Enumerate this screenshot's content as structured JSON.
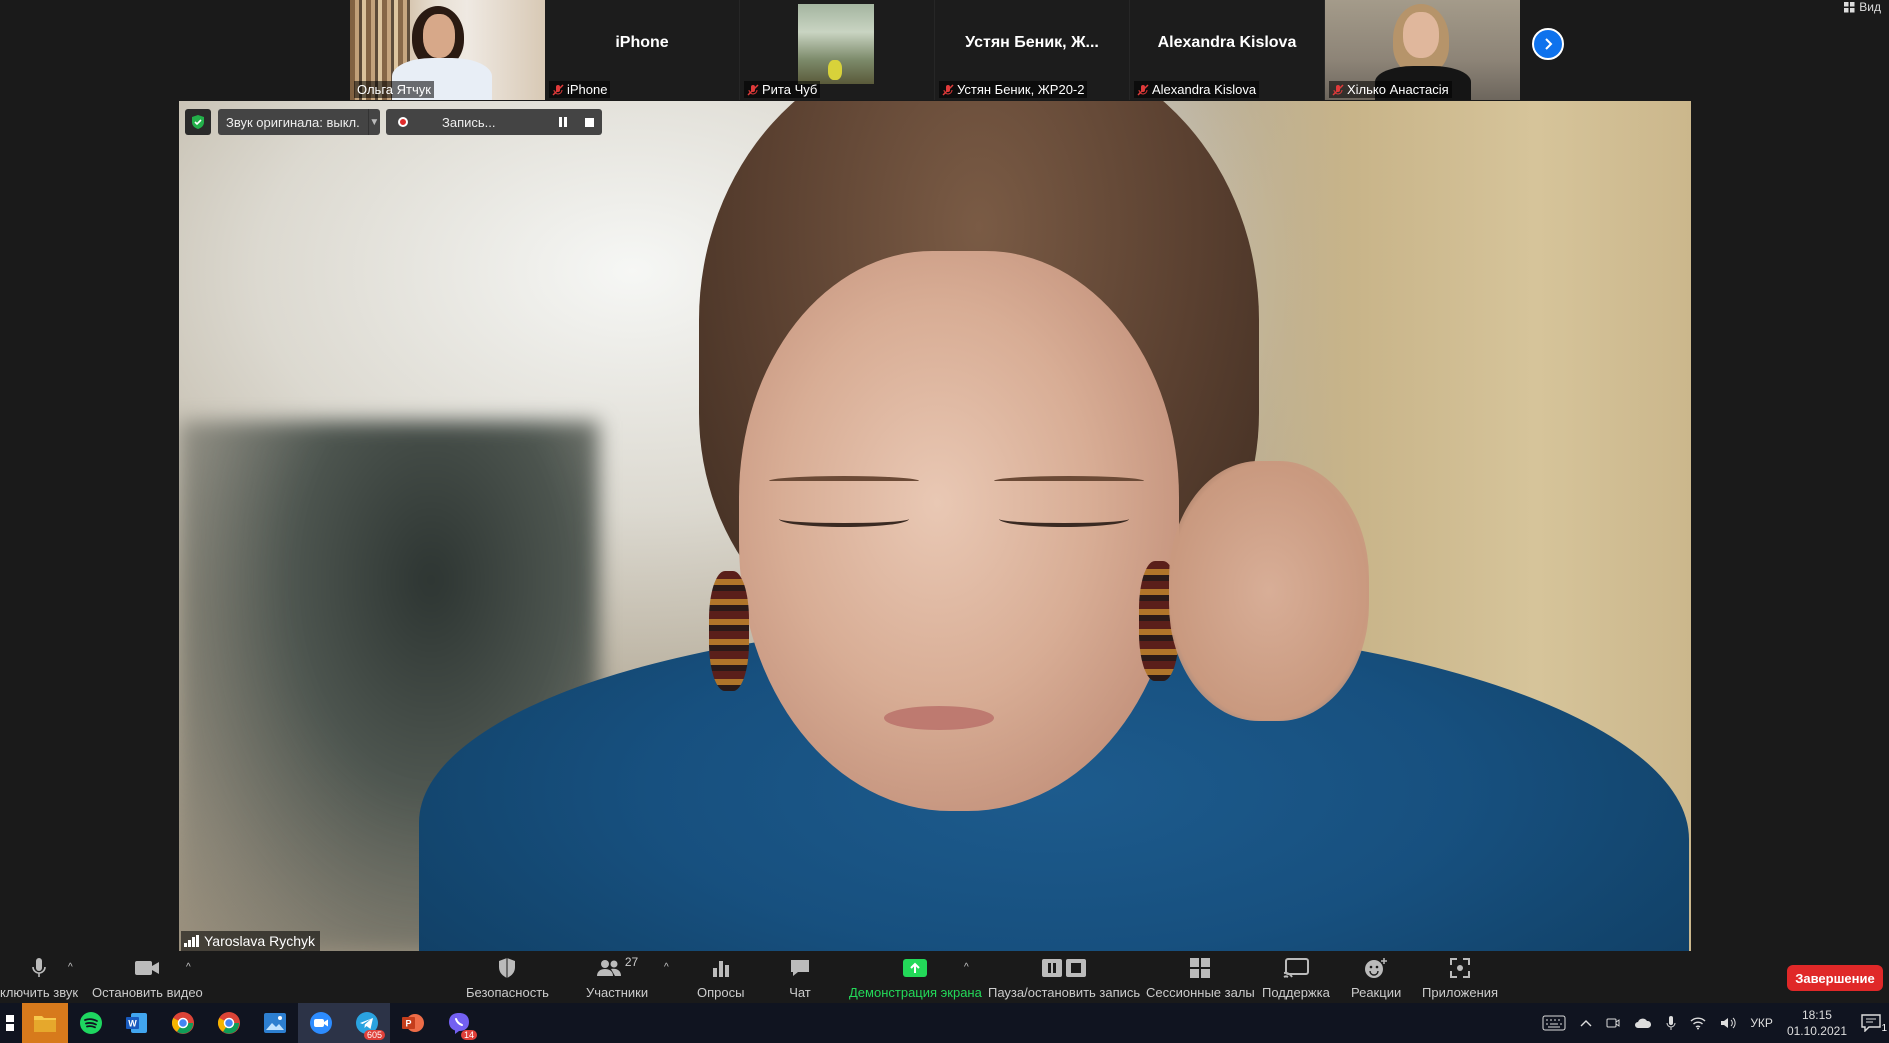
{
  "strip": {
    "tiles": [
      {
        "label": "Ольга Ятчук",
        "name": ""
      },
      {
        "label": "iPhone",
        "name": "iPhone"
      },
      {
        "label": "Рита Чуб",
        "name": ""
      },
      {
        "label": "Устян Беник, ЖР20-2",
        "name": "Устян  Беник,  Ж..."
      },
      {
        "label": "Alexandra Kislova",
        "name": "Alexandra Kislova"
      },
      {
        "label": "Хілько  Анастасія",
        "name": ""
      }
    ],
    "view_label": "Вид"
  },
  "main": {
    "speaker": "Yaroslava Rychyk",
    "orig_audio": "Звук оригинала: выкл.",
    "recording": "Запись..."
  },
  "toolbar": {
    "mute": "ключить звук",
    "video": "Остановить видео",
    "security": "Безопасность",
    "participants": "Участники",
    "participants_count": "27",
    "polls": "Опросы",
    "chat": "Чат",
    "share": "Демонстрация экрана",
    "pause_rec": "Пауза/остановить запись",
    "breakout": "Сессионные залы",
    "support": "Поддержка",
    "reactions": "Реакции",
    "apps": "Приложения",
    "end": "Завершение",
    "share_color": "#23d959",
    "end_color": "#e02828"
  },
  "taskbar": {
    "telegram_badge": "605",
    "viber_badge": "14",
    "lang": "УКР",
    "time": "18:15",
    "date": "01.10.2021",
    "notif_count": "1"
  }
}
